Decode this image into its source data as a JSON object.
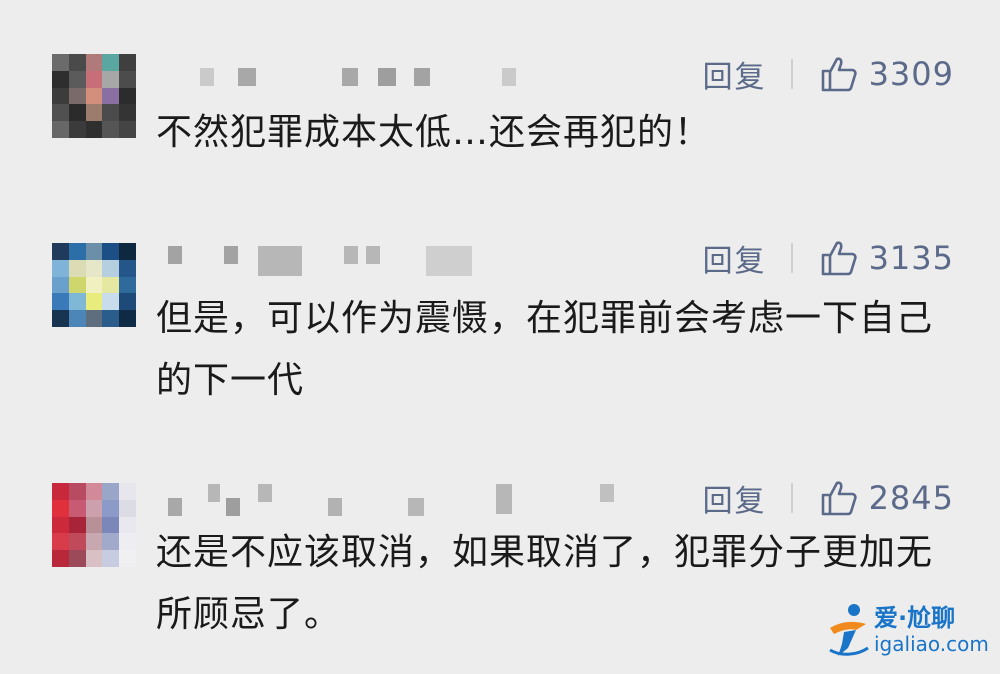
{
  "comments": [
    {
      "reply_label": "回复",
      "likes": "3309",
      "text": "不然犯罪成本太低…还会再犯的！"
    },
    {
      "reply_label": "回复",
      "likes": "3135",
      "text": "但是，可以作为震慑，在犯罪前会考虑一下自己的下一代"
    },
    {
      "reply_label": "回复",
      "likes": "2845",
      "text": "还是不应该取消，如果取消了，犯罪分子更加无所顾忌了。"
    }
  ],
  "watermark": {
    "title": "爱·尬聊",
    "site": "igaliao.com"
  },
  "colors": {
    "background": "#ededed",
    "action_text": "#5c6a8a",
    "watermark": "#1a75c9"
  },
  "icons": [
    "thumbs-up-icon"
  ]
}
